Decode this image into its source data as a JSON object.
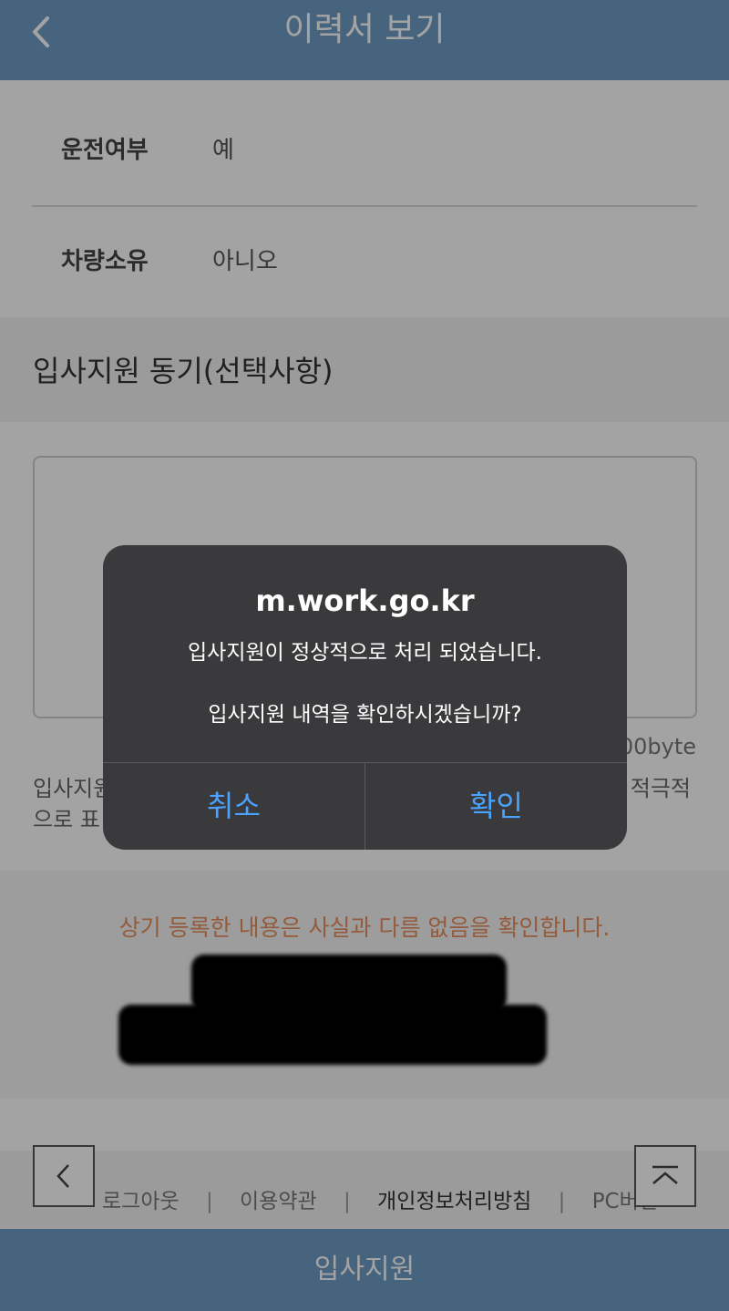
{
  "header": {
    "title": "이력서 보기"
  },
  "rows": [
    {
      "label": "운전여부",
      "value": "예"
    },
    {
      "label": "차량소유",
      "value": "아니오"
    }
  ],
  "section": {
    "title": "입사지원 동기(선택사항)"
  },
  "textarea": {
    "byte_count": "00byte"
  },
  "helper": {
    "text_left": "입사지원",
    "text_right": "적극적",
    "text_line2": "으로 표"
  },
  "confirm": {
    "text": "상기 등록한 내용은 사실과 다름 없음을 확인합니다."
  },
  "footer": {
    "links": [
      "로그아웃",
      "이용약관",
      "개인정보처리방침",
      "PC버전"
    ]
  },
  "bottom_button": {
    "label": "입사지원"
  },
  "dialog": {
    "title": "m.work.go.kr",
    "message_1": "입사지원이 정상적으로 처리 되었습니다.",
    "message_2": "입사지원 내역을 확인하시겠습니까?",
    "cancel_label": "취소",
    "ok_label": "확인"
  },
  "colors": {
    "primary": "#6f9dc7",
    "accent_orange": "#e88f5e",
    "dialog_button": "#4aa3ff"
  }
}
